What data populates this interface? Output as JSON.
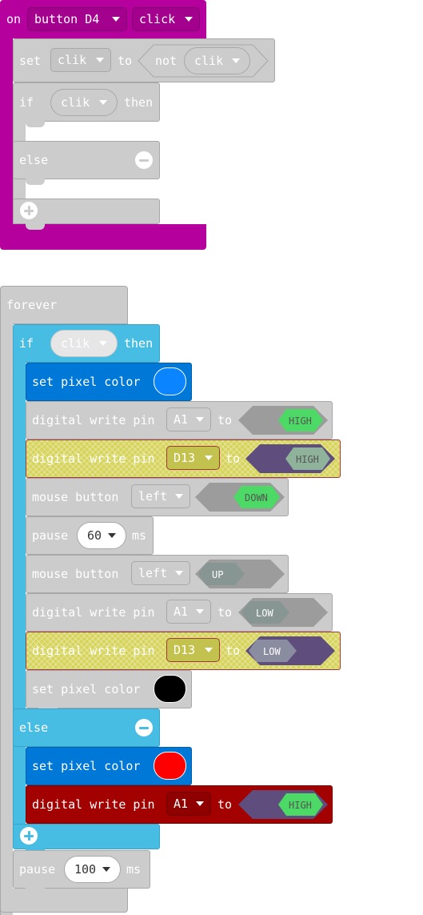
{
  "event_block": {
    "on": "on",
    "button": "button D4",
    "action": "click",
    "set": "set",
    "var": "clik",
    "to": "to",
    "not": "not",
    "if": "if",
    "then": "then",
    "else": "else"
  },
  "forever_block": {
    "forever": "forever",
    "if": "if",
    "cond": "clik",
    "then": "then",
    "else": "else",
    "set_pixel": "set pixel color",
    "digital_write": "digital write pin",
    "to": "to",
    "mouse_button": "mouse button",
    "left": "left",
    "pause": "pause",
    "ms": "ms",
    "pins": {
      "a1": "A1",
      "d13": "D13"
    },
    "values": {
      "high": "HIGH",
      "low": "LOW",
      "down": "DOWN",
      "up": "UP"
    },
    "pause_inner": "60",
    "pause_outer": "100"
  },
  "colors": {
    "event": "#b5009d",
    "logic": "#48bde4",
    "pixel": "#0078d7",
    "red_block": "#a30000",
    "blue_swatch": "#0a84ff",
    "black_swatch": "#000000",
    "red_swatch": "#ff0000",
    "high_green": "#4dd965"
  }
}
